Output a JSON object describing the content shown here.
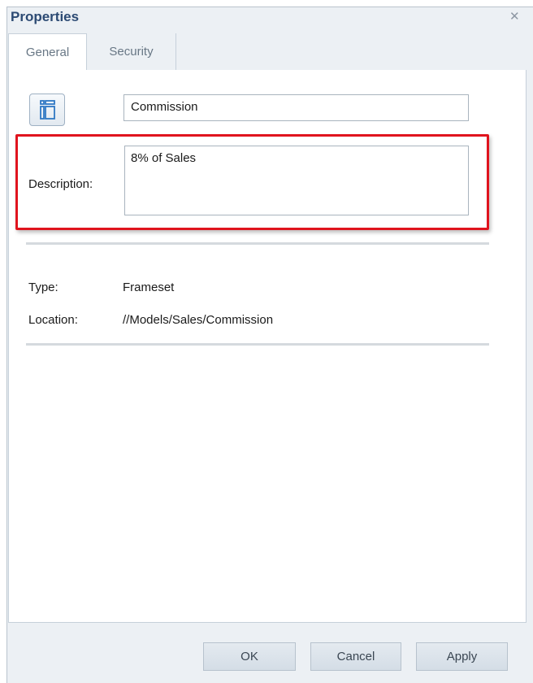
{
  "dialog": {
    "title": "Properties",
    "close_icon": "close-icon"
  },
  "tabs": [
    {
      "label": "General",
      "active": true
    },
    {
      "label": "Security",
      "active": false
    }
  ],
  "general": {
    "item_icon": "frameset-icon",
    "name_value": "Commission",
    "description_label": "Description:",
    "description_value": "8% of Sales",
    "type_label": "Type:",
    "type_value": "Frameset",
    "location_label": "Location:",
    "location_value": "//Models/Sales/Commission"
  },
  "buttons": {
    "ok": "OK",
    "cancel": "Cancel",
    "apply": "Apply"
  },
  "colors": {
    "title": "#2c4a73",
    "highlight": "#e0141e",
    "background": "#ecf0f4"
  }
}
